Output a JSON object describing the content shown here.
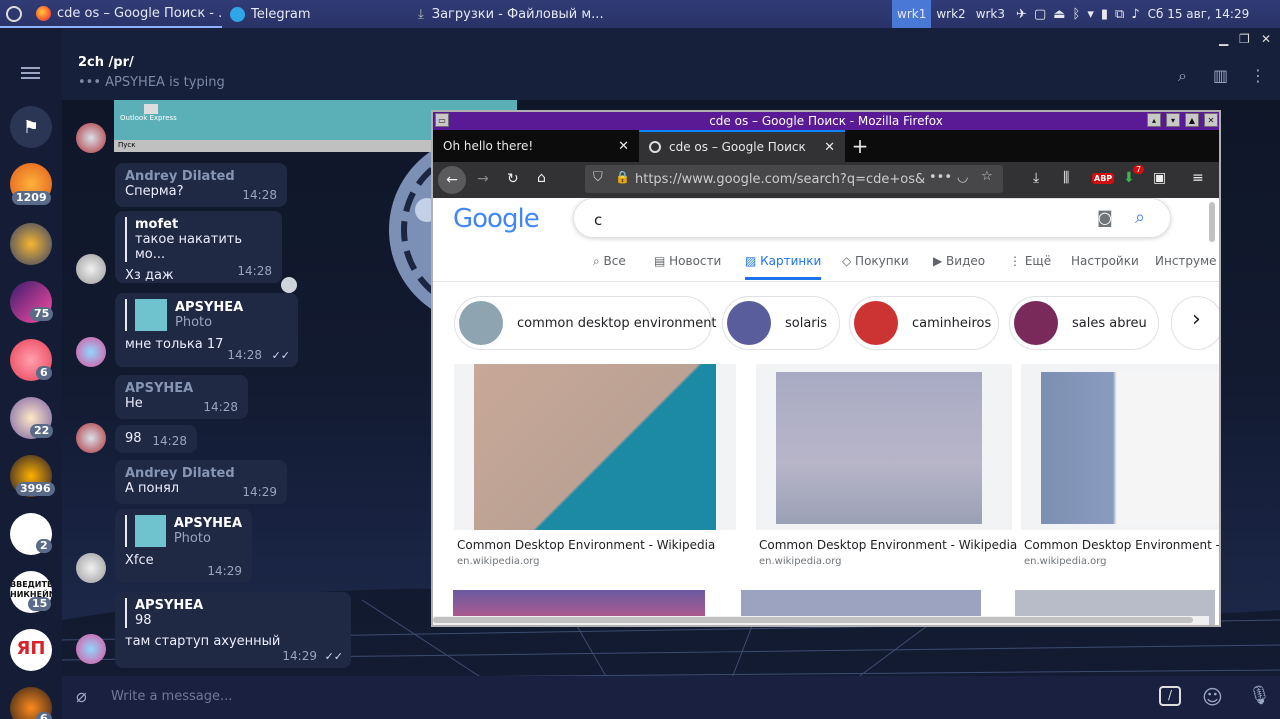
{
  "taskbar": {
    "tasks": [
      {
        "label": "cde os – Google Поиск - ...",
        "icon": "firefox-icon"
      },
      {
        "label": "Telegram",
        "icon": "telegram-icon"
      },
      {
        "label": "Загрузки - Файловый м...",
        "icon": "download-icon"
      }
    ],
    "workspaces": [
      "wrk1",
      "wrk2",
      "wrk3"
    ],
    "clock": "Сб 15 авг, 14:29"
  },
  "telegram": {
    "chat_title": "2ch /pr/",
    "typing": "••• APSYHEA is typing",
    "sidebar_badges": [
      "1209",
      "75",
      "6",
      "22",
      "3996",
      "2",
      "15",
      "6"
    ],
    "sidebar_text": [
      "ВВЕДИТЕ НИКНЕЙМ",
      "ЯП"
    ],
    "message_placeholder": "Write a message...",
    "snippet": [
      "Outlook Express",
      "Пуск"
    ],
    "messages": [
      {
        "name": "Andrey Dilated",
        "text": "Сперма?",
        "time": "14:28"
      },
      {
        "quote_name": "mofet",
        "quote_text": "такое накатить мо...",
        "text": "Хз даж",
        "time": "14:28"
      },
      {
        "quote_name": "APSYHEA",
        "quote_text": "Photo",
        "text": "мне толька 17",
        "time": "14:28"
      },
      {
        "name": "APSYHEA",
        "text": "Не",
        "time": "14:28"
      },
      {
        "text": "98",
        "time": "14:28"
      },
      {
        "name": "Andrey Dilated",
        "text": "А понял",
        "time": "14:29"
      },
      {
        "quote_name": "APSYHEA",
        "quote_text": "Photo",
        "text": "Xfce",
        "time": "14:29"
      },
      {
        "quote_name": "APSYHEA",
        "quote_text": "98",
        "text": "там стартуп ахуенный",
        "time": "14:29"
      }
    ]
  },
  "firefox": {
    "window_title": "cde os – Google Поиск - Mozilla Firefox",
    "tabs": [
      "Oh hello there!",
      "cde os – Google Поиск"
    ],
    "url": "https://www.google.com/search?q=cde+os&c",
    "url_domain": "www.google.com",
    "abp": "ABP",
    "badge": "7",
    "search_value": "c",
    "google_logo": "Google",
    "search_tabs": [
      "Все",
      "Новости",
      "Картинки",
      "Покупки",
      "Видео",
      "⋮ Ещё",
      "Настройки",
      "Инструме"
    ],
    "chips": [
      "common desktop environment",
      "solaris",
      "caminheiros",
      "sales abreu"
    ],
    "results": [
      {
        "title": "Common Desktop Environment - Wikipedia",
        "source": "en.wikipedia.org"
      },
      {
        "title": "Common Desktop Environment - Wikipedia",
        "source": "en.wikipedia.org"
      },
      {
        "title": "Common Desktop Environment - Wi",
        "source": "en.wikipedia.org"
      }
    ]
  }
}
